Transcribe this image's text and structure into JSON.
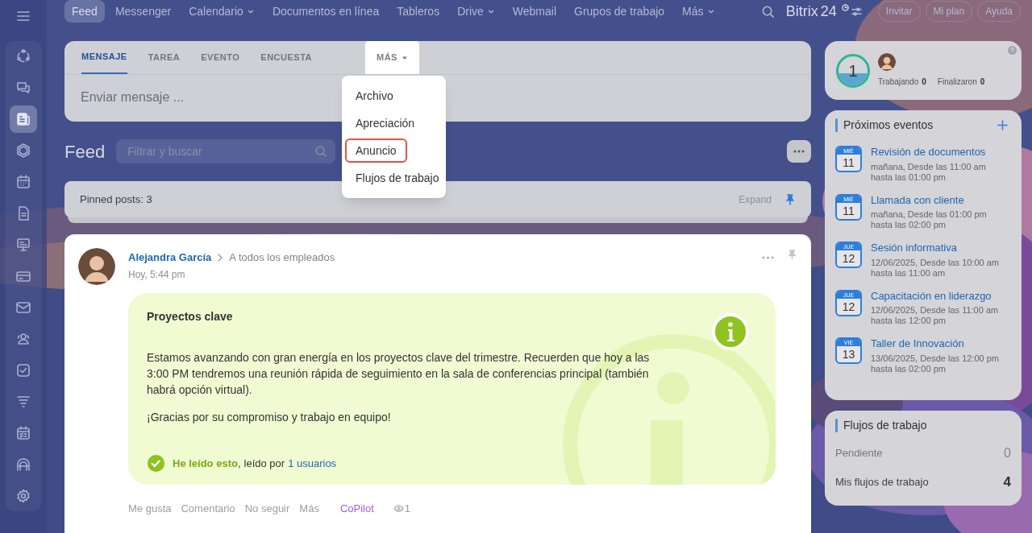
{
  "sidebar": {
    "items": [
      {
        "selected": false
      },
      {
        "selected": false
      },
      {
        "selected": true
      },
      {
        "selected": false
      },
      {
        "selected": false
      },
      {
        "selected": false
      },
      {
        "selected": false
      },
      {
        "selected": false
      },
      {
        "selected": false
      },
      {
        "selected": false
      },
      {
        "selected": false
      },
      {
        "selected": false
      },
      {
        "selected": false
      },
      {
        "selected": false
      },
      {
        "selected": false
      }
    ]
  },
  "top_nav": {
    "items": [
      {
        "label": "Feed",
        "selected": true,
        "dropdown": false
      },
      {
        "label": "Messenger",
        "selected": false,
        "dropdown": false
      },
      {
        "label": "Calendario",
        "selected": false,
        "dropdown": true
      },
      {
        "label": "Documentos en línea",
        "selected": false,
        "dropdown": false
      },
      {
        "label": "Tableros",
        "selected": false,
        "dropdown": false
      },
      {
        "label": "Drive",
        "selected": false,
        "dropdown": true
      },
      {
        "label": "Webmail",
        "selected": false,
        "dropdown": false
      },
      {
        "label": "Grupos de trabajo",
        "selected": false,
        "dropdown": false
      },
      {
        "label": "Más",
        "selected": false,
        "dropdown": true
      }
    ],
    "logo": {
      "name": "Bitrix",
      "number": "24"
    },
    "buttons": [
      "Invitar",
      "Mi plan",
      "Ayuda"
    ]
  },
  "composer": {
    "tabs": [
      {
        "label": "MENSAJE",
        "selected": true,
        "expanded": false
      },
      {
        "label": "TAREA",
        "selected": false,
        "expanded": false
      },
      {
        "label": "EVENTO",
        "selected": false,
        "expanded": false
      },
      {
        "label": "ENCUESTA",
        "selected": false,
        "expanded": false
      },
      {
        "label": "MÁS",
        "selected": false,
        "expanded": true
      }
    ],
    "placeholder": "Enviar mensaje ...",
    "menu": [
      {
        "label": "Archivo",
        "highlighted": false
      },
      {
        "label": "Apreciación",
        "highlighted": false
      },
      {
        "label": "Anuncio",
        "highlighted": true
      },
      {
        "label": "Flujos de trabajo",
        "highlighted": false
      }
    ]
  },
  "feed": {
    "title": "Feed",
    "filter": {
      "placeholder": "Filtrar y buscar"
    }
  },
  "pinned": {
    "text": "Pinned posts: 3",
    "expand": "Expand"
  },
  "post": {
    "author": "Alejandra García",
    "recipient": "A todos los empleados",
    "time": "Hoy, 5:44 pm",
    "title": "Proyectos clave",
    "paragraphs": [
      "Estamos avanzando con gran energía en los proyectos clave del trimestre. Recuerden que hoy a las 3:00 PM tendremos una reunión rápida de seguimiento en la sala de conferencias principal (también habrá opción virtual).",
      "¡Gracias por su compromiso y trabajo en equipo!"
    ],
    "read": {
      "checked": true,
      "label": "He leído esto",
      "separator": ",",
      "by": "leído por",
      "link": "1 usuarios"
    },
    "actions": [
      {
        "label": "Me gusta",
        "kind": "plain"
      },
      {
        "label": "Comentario",
        "kind": "plain"
      },
      {
        "label": "No seguir",
        "kind": "plain"
      },
      {
        "label": "Más",
        "kind": "plain"
      },
      {
        "label": "CoPilot",
        "kind": "ai"
      }
    ],
    "views": "1"
  },
  "worktime": {
    "count": "1",
    "stats": [
      {
        "label": "Trabajando",
        "value": "0"
      },
      {
        "label": "Finalizaron",
        "value": "0"
      }
    ]
  },
  "events": {
    "title": "Próximos eventos",
    "items": [
      {
        "weekday": "MIÉ",
        "day": "11",
        "title": "Revisión de documentos",
        "line1": "mañana, Desde las 11:00 am",
        "line2": "hasta las 01:00 pm"
      },
      {
        "weekday": "MIÉ",
        "day": "11",
        "title": "Llamada con cliente",
        "line1": "mañana, Desde las 01:00 pm",
        "line2": "hasta las 02:00 pm"
      },
      {
        "weekday": "JUE",
        "day": "12",
        "title": "Sesión informativa",
        "line1": "12/06/2025, Desde las 10:00 am",
        "line2": "hasta las 11:00 am"
      },
      {
        "weekday": "JUE",
        "day": "12",
        "title": "Capacitación en liderazgo",
        "line1": "12/06/2025, Desde las 11:00 am",
        "line2": "hasta las 12:00 pm"
      },
      {
        "weekday": "VIE",
        "day": "13",
        "title": "Taller de Innovación",
        "line1": "13/06/2025, Desde las 12:00 pm",
        "line2": "hasta las 02:00 pm"
      }
    ]
  },
  "workflows": {
    "title": "Flujos de trabajo",
    "rows": [
      {
        "label": "Pendiente",
        "value": "0",
        "muted": true
      },
      {
        "label": "Mis flujos de trabajo",
        "value": "4",
        "muted": false
      }
    ]
  }
}
